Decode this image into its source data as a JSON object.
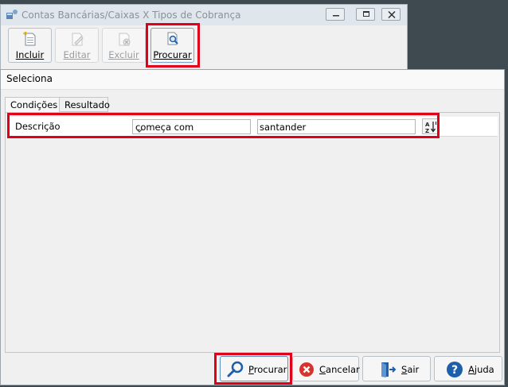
{
  "background_window": {
    "title": "Contas Bancárias/Caixas X Tipos de Cobrança",
    "toolbar": [
      {
        "label": "Incluir",
        "accel": "I",
        "rest": "ncluir",
        "enabled": true,
        "icon": "new-document-icon"
      },
      {
        "label": "Editar",
        "accel": "E",
        "rest": "ditar",
        "enabled": false,
        "icon": "edit-document-icon"
      },
      {
        "label": "Excluir",
        "accel": "x",
        "rest": "Excluir",
        "enabled": false,
        "icon": "delete-document-icon"
      },
      {
        "label": "Procurar",
        "accel": "P",
        "rest": "rocurar",
        "enabled": true,
        "icon": "search-document-icon"
      }
    ]
  },
  "dialog": {
    "title": "Seleciona",
    "tabs": [
      {
        "label": "Condições",
        "active": true
      },
      {
        "label": "Resultado",
        "active": false
      }
    ],
    "condition": {
      "field": "Descrição",
      "operator": "começa com",
      "value": "santander",
      "sort_icon": "sort-az-icon"
    },
    "buttons": {
      "procurar": {
        "accel": "P",
        "rest": "rocurar",
        "icon": "magnifier-icon"
      },
      "cancelar": {
        "accel": "C",
        "rest": "ancelar",
        "icon": "cancel-icon"
      },
      "sair": {
        "accel": "S",
        "rest": "air",
        "icon": "exit-door-icon"
      },
      "ajuda": {
        "accel": "A",
        "rest": "juda",
        "icon": "help-icon"
      }
    }
  },
  "colors": {
    "highlight": "#e0001a",
    "accent_blue": "#1d5fa8",
    "cancel_red": "#d9342b"
  }
}
